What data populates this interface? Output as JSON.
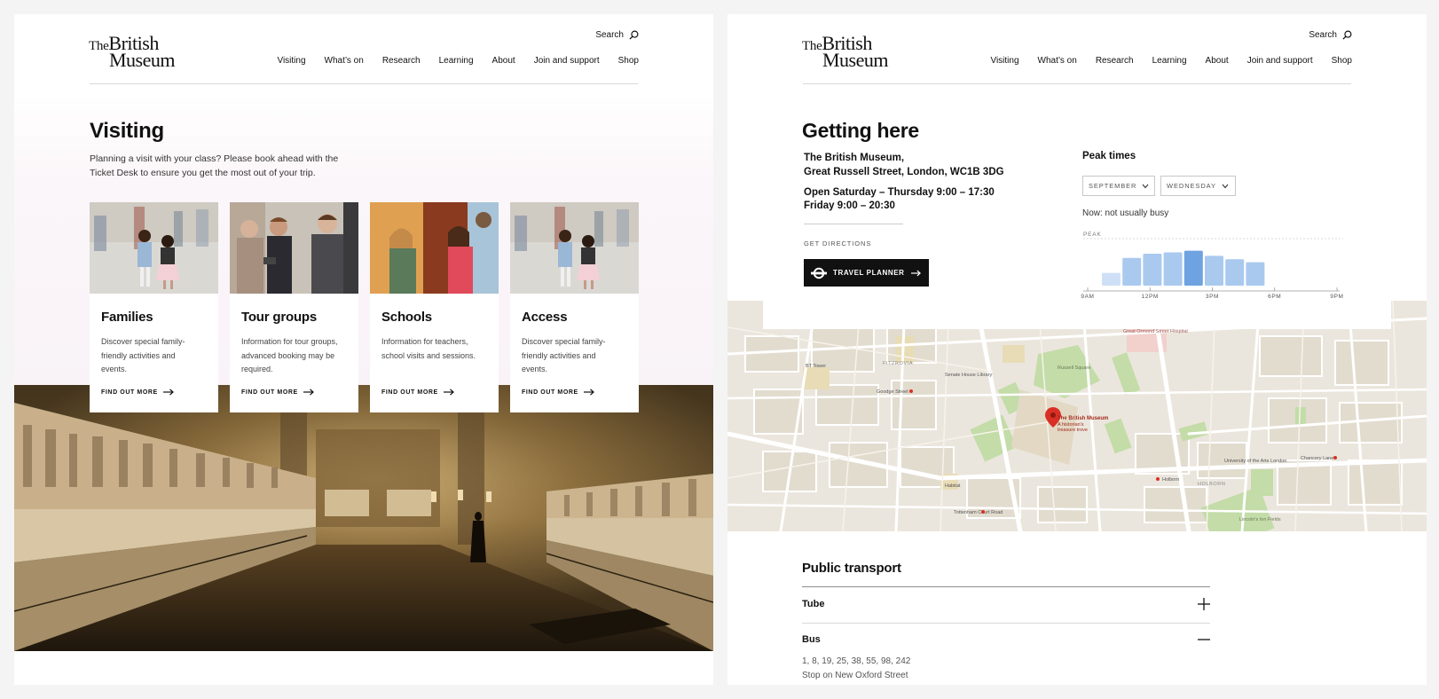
{
  "header": {
    "logo_the": "The",
    "logo_british": "British",
    "logo_museum": "Museum",
    "search_label": "Search",
    "nav": [
      "Visiting",
      "What’s on",
      "Research",
      "Learning",
      "About",
      "Join and support",
      "Shop"
    ]
  },
  "visiting": {
    "title": "Visiting",
    "intro": "Planning a visit with your class? Please book ahead with the Ticket Desk to ensure you get the most out of your trip.",
    "cards": [
      {
        "title": "Families",
        "text": "Discover special family-friendly activities and events.",
        "link": "FIND OUT MORE"
      },
      {
        "title": "Tour groups",
        "text": "Information for tour groups, advanced booking may be required.",
        "link": "FIND OUT MORE"
      },
      {
        "title": "Schools",
        "text": "Information for teachers, school visits and sessions.",
        "link": "FIND OUT MORE"
      },
      {
        "title": "Access",
        "text": "Discover special family-friendly activities and events.",
        "link": "FIND OUT MORE"
      }
    ]
  },
  "getting_here": {
    "title": "Getting here",
    "address_line1": "The British Museum,",
    "address_line2": "Great Russell Street, London, WC1B 3DG",
    "hours_line1": "Open Saturday – Thursday 9:00 – 17:30",
    "hours_line2": "Friday 9:00 – 20:30",
    "directions_label": "GET DIRECTIONS",
    "planner_label": "TRAVEL PLANNER"
  },
  "peak_times": {
    "title": "Peak times",
    "month": "SEPTEMBER",
    "day": "WEDNESDAY",
    "now": "Now: not usually busy",
    "peak_label": "PEAK",
    "ticks": [
      "9AM",
      "12PM",
      "3PM",
      "6PM",
      "9PM"
    ],
    "busyness": [
      0.3,
      0.65,
      0.75,
      0.78,
      0.82,
      0.7,
      0.62,
      0.55
    ],
    "current_index": 4,
    "colors": {
      "bar": "#a9c9ef",
      "bar_light": "#cfe0f6",
      "bar_now": "#6fa2e0"
    }
  },
  "map": {
    "labels": {
      "museum": "The British Museum",
      "museum_sub1": "A historian's",
      "museum_sub2": "treasure trove",
      "russell_square": "Russell Square",
      "gt_ormond": "Great Ormond Street Hospital",
      "bt_tower": "BT Tower",
      "fitzrovia": "FITZROVIA",
      "goodge": "Goodge Street",
      "senate": "Senate House Library",
      "tcr": "Tottenham Court Road",
      "holborn_stn": "Holborn",
      "holborn": "HOLBORN",
      "chancery": "Chancery Lane",
      "uni_arts": "University of the Arts London",
      "lincolns": "Lincoln's Inn Fields",
      "habitat": "Habitat"
    },
    "pin_color": "#d93025"
  },
  "public_transport": {
    "title": "Public transport",
    "items": [
      {
        "label": "Tube",
        "expanded": false
      },
      {
        "label": "Bus",
        "expanded": true
      }
    ],
    "bus_routes": "1, 8, 19, 25, 38, 55, 98, 242",
    "bus_stop": "Stop on New Oxford Street"
  }
}
